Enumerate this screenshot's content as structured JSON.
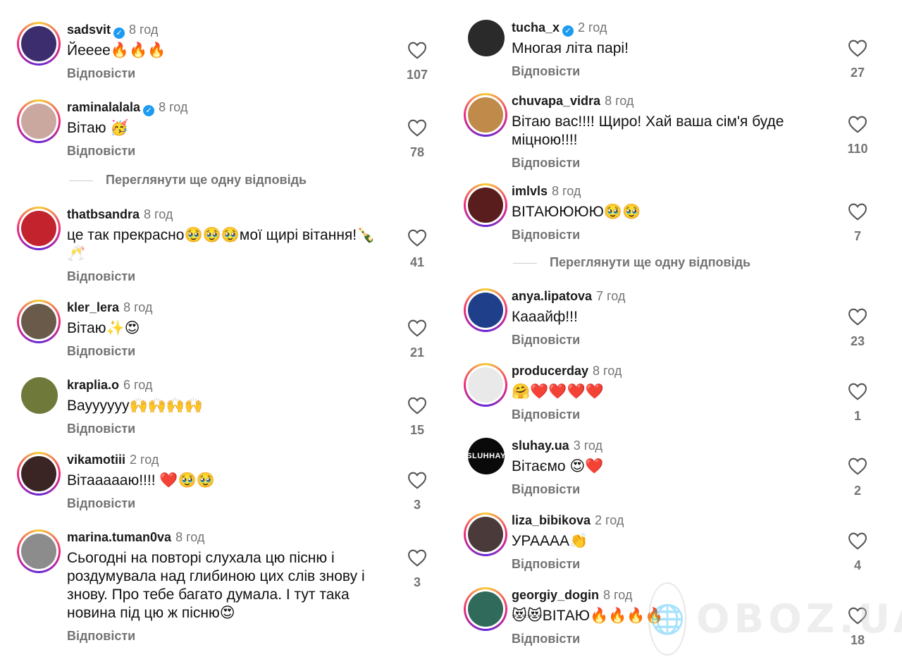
{
  "reply_label": "Відповісти",
  "view_more_label": "Переглянути ще одну відповідь",
  "watermark": "OBOZ.UA",
  "left_comments": [
    {
      "username": "sadsvit",
      "verified": true,
      "time": "8 год",
      "text": "Йееее🔥🔥🔥",
      "likes": "107",
      "avatar_color": "#3b2d6e",
      "avatar_style": "story"
    },
    {
      "username": "raminalalala",
      "verified": true,
      "time": "8 год",
      "text": "Вітаю 🥳",
      "likes": "78",
      "avatar_color": "#caa8a0",
      "avatar_style": "story"
    },
    {
      "username": "thatbsandra",
      "verified": false,
      "time": "8 год",
      "text": "це так прекрасно🥹🥹🥹мої щирі вітання!🍾🥂",
      "likes": "41",
      "avatar_color": "#c2232d",
      "avatar_style": "story"
    },
    {
      "username": "kler_lera",
      "verified": false,
      "time": "8 год",
      "text": "Вітаю✨😍",
      "likes": "21",
      "avatar_color": "#6a5a4a",
      "avatar_style": "story"
    },
    {
      "username": "kraplia.o",
      "verified": false,
      "time": "6 год",
      "text": "Вауууууу🙌🙌🙌🙌",
      "likes": "15",
      "avatar_color": "#6f7a3a",
      "avatar_style": "plain"
    },
    {
      "username": "vikamotiii",
      "verified": false,
      "time": "2 год",
      "text": "Вітаааааю!!!! ❤️🥹🥹",
      "likes": "3",
      "avatar_color": "#3a2424",
      "avatar_style": "story"
    },
    {
      "username": "marina.tuman0va",
      "verified": false,
      "time": "8 год",
      "text": "Сьогодні на повторі слухала цю пісню і роздумувала над глибиною цих слів знову і знову. Про тебе багато думала. І тут така новина під цю ж пісню😍",
      "likes": "3",
      "avatar_color": "#8c8c8c",
      "avatar_style": "story"
    }
  ],
  "right_comments": [
    {
      "username": "tucha_x",
      "verified": true,
      "time": "2 год",
      "text": "Многая літа парі!",
      "likes": "27",
      "avatar_color": "#2a2a2a",
      "avatar_style": "plain"
    },
    {
      "username": "chuvapa_vidra",
      "verified": false,
      "time": "8 год",
      "text": "Вітаю вас!!!! Щиро! Хай ваша сім'я буде міцною!!!!",
      "likes": "110",
      "avatar_color": "#c08a4a",
      "avatar_style": "story"
    },
    {
      "username": "imlvls",
      "verified": false,
      "time": "8 год",
      "text": "ВІТАЮЮЮЮ🥹🥹",
      "likes": "7",
      "avatar_color": "#5a1d1d",
      "avatar_style": "story"
    },
    {
      "username": "anya.lipatova",
      "verified": false,
      "time": "7 год",
      "text": "Кааайф!!!",
      "likes": "23",
      "avatar_color": "#1f3f8a",
      "avatar_style": "story"
    },
    {
      "username": "producerday",
      "verified": false,
      "time": "8 год",
      "text": "🤗❤️❤️❤️❤️",
      "likes": "1",
      "avatar_color": "#e9e9e9",
      "avatar_style": "story"
    },
    {
      "username": "sluhay.ua",
      "verified": false,
      "time": "3 год",
      "text": "Вітаємо 😍❤️",
      "likes": "2",
      "avatar_color": "#0a0a0a",
      "avatar_text": "SLUHHAY",
      "avatar_style": "plain"
    },
    {
      "username": "liza_bibikova",
      "verified": false,
      "time": "2 год",
      "text": "УРАААА👏",
      "likes": "4",
      "avatar_color": "#4a3a3a",
      "avatar_style": "story"
    },
    {
      "username": "georgiy_dogin",
      "verified": false,
      "time": "8 год",
      "text": "😻😻ВІТАЮ🔥🔥🔥🔥",
      "likes": "18",
      "avatar_color": "#2f6a5a",
      "avatar_style": "story"
    }
  ]
}
